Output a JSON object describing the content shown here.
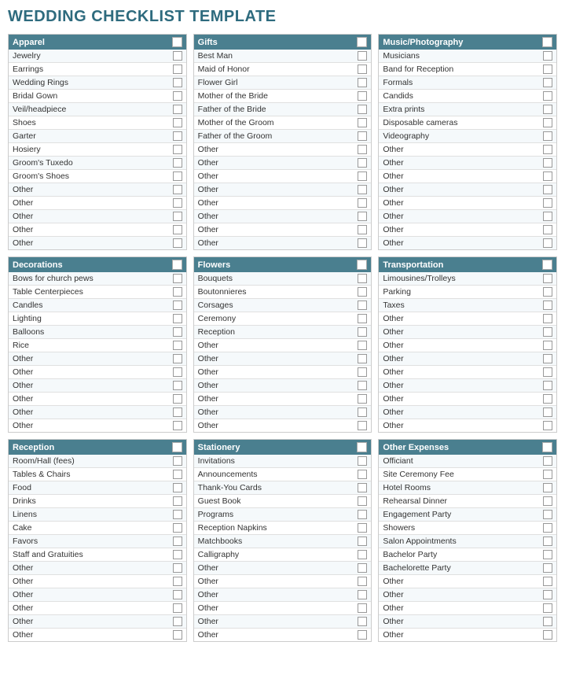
{
  "title": "WEDDING CHECKLIST TEMPLATE",
  "sections": [
    {
      "id": "apparel",
      "label": "Apparel",
      "items": [
        "Jewelry",
        "Earrings",
        "Wedding Rings",
        "Bridal Gown",
        "Veil/headpiece",
        "Shoes",
        "Garter",
        "Hosiery",
        "Groom's Tuxedo",
        "Groom's Shoes",
        "Other",
        "Other",
        "Other",
        "Other",
        "Other"
      ]
    },
    {
      "id": "gifts",
      "label": "Gifts",
      "items": [
        "Best Man",
        "Maid of Honor",
        "Flower Girl",
        "Mother of the Bride",
        "Father of the Bride",
        "Mother of the Groom",
        "Father of the Groom",
        "Other",
        "Other",
        "Other",
        "Other",
        "Other",
        "Other",
        "Other",
        "Other"
      ]
    },
    {
      "id": "music-photography",
      "label": "Music/Photography",
      "items": [
        "Musicians",
        "Band for Reception",
        "Formals",
        "Candids",
        "Extra prints",
        "Disposable cameras",
        "Videography",
        "Other",
        "Other",
        "Other",
        "Other",
        "Other",
        "Other",
        "Other",
        "Other"
      ]
    },
    {
      "id": "decorations",
      "label": "Decorations",
      "items": [
        "Bows for church pews",
        "Table Centerpieces",
        "Candles",
        "Lighting",
        "Balloons",
        "Rice",
        "Other",
        "Other",
        "Other",
        "Other",
        "Other",
        "Other"
      ]
    },
    {
      "id": "flowers",
      "label": "Flowers",
      "items": [
        "Bouquets",
        "Boutonnieres",
        "Corsages",
        "Ceremony",
        "Reception",
        "Other",
        "Other",
        "Other",
        "Other",
        "Other",
        "Other",
        "Other"
      ]
    },
    {
      "id": "transportation",
      "label": "Transportation",
      "items": [
        "Limousines/Trolleys",
        "Parking",
        "Taxes",
        "Other",
        "Other",
        "Other",
        "Other",
        "Other",
        "Other",
        "Other",
        "Other",
        "Other"
      ]
    },
    {
      "id": "reception",
      "label": "Reception",
      "items": [
        "Room/Hall (fees)",
        "Tables & Chairs",
        "Food",
        "Drinks",
        "Linens",
        "Cake",
        "Favors",
        "Staff and Gratuities",
        "Other",
        "Other",
        "Other",
        "Other",
        "Other",
        "Other"
      ]
    },
    {
      "id": "stationery",
      "label": "Stationery",
      "items": [
        "Invitations",
        "Announcements",
        "Thank-You Cards",
        "Guest Book",
        "Programs",
        "Reception Napkins",
        "Matchbooks",
        "Calligraphy",
        "Other",
        "Other",
        "Other",
        "Other",
        "Other",
        "Other"
      ]
    },
    {
      "id": "other-expenses",
      "label": "Other Expenses",
      "items": [
        "Officiant",
        "Site Ceremony Fee",
        "Hotel Rooms",
        "Rehearsal Dinner",
        "Engagement Party",
        "Showers",
        "Salon Appointments",
        "Bachelor Party",
        "Bachelorette Party",
        "Other",
        "Other",
        "Other",
        "Other",
        "Other"
      ]
    }
  ]
}
